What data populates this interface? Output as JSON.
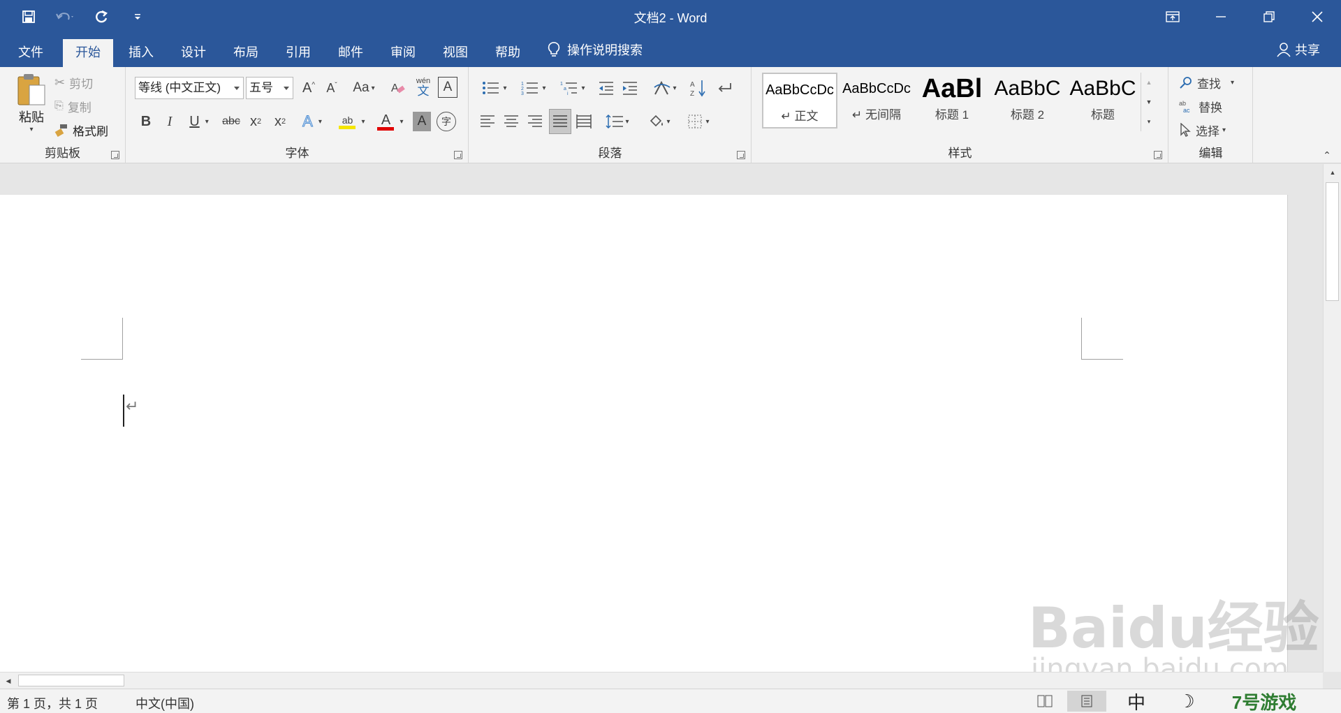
{
  "window": {
    "title": "文档2 - Word",
    "accent": "#2b579a"
  },
  "qat": {
    "save_icon": "save-icon",
    "undo_icon": "undo-icon",
    "redo_icon": "redo-icon",
    "customize_icon": "customize-qat-icon"
  },
  "tabs": [
    "文件",
    "开始",
    "插入",
    "设计",
    "布局",
    "引用",
    "邮件",
    "审阅",
    "视图",
    "帮助"
  ],
  "active_tab": "开始",
  "tell_me": "操作说明搜索",
  "share": "共享",
  "clipboard": {
    "paste": "粘贴",
    "cut": "剪切",
    "copy": "复制",
    "format_painter": "格式刷",
    "label": "剪贴板"
  },
  "font": {
    "family": "等线 (中文正文)",
    "size": "五号",
    "label": "字体",
    "change_case": "Aa",
    "bold": "B",
    "italic": "I",
    "underline": "U",
    "strikethrough": "abc",
    "subscript": "x",
    "subscript_mark": "2",
    "superscript": "x",
    "superscript_mark": "2",
    "text_effects": "A",
    "highlight": "ab",
    "font_color": "A",
    "char_shading": "A",
    "enclose": "字",
    "pinyin_top": "wén",
    "pinyin_bottom": "文",
    "char_border": "A",
    "highlight_color": "#f5e600",
    "font_color_value": "#e00000"
  },
  "paragraph": {
    "label": "段落"
  },
  "styles": {
    "label": "样式",
    "items": [
      {
        "sample": "AaBbCcDc",
        "name": "↵ 正文"
      },
      {
        "sample": "AaBbCcDc",
        "name": "↵ 无间隔"
      },
      {
        "sample": "AaBl",
        "name": "标题 1"
      },
      {
        "sample": "AaBbC",
        "name": "标题 2"
      },
      {
        "sample": "AaBbC",
        "name": "标题"
      }
    ]
  },
  "editing": {
    "label": "编辑",
    "find": "查找",
    "replace": "替换",
    "select": "选择"
  },
  "document": {
    "paragraph_mark": "↵"
  },
  "status": {
    "page_info": "第 1 页，共 1 页",
    "language": "中文(中国)",
    "ime": "中"
  },
  "watermark": {
    "brand": "Baidu经验",
    "url": "jingyan.baidu.com",
    "game_brand": "7号游戏"
  }
}
